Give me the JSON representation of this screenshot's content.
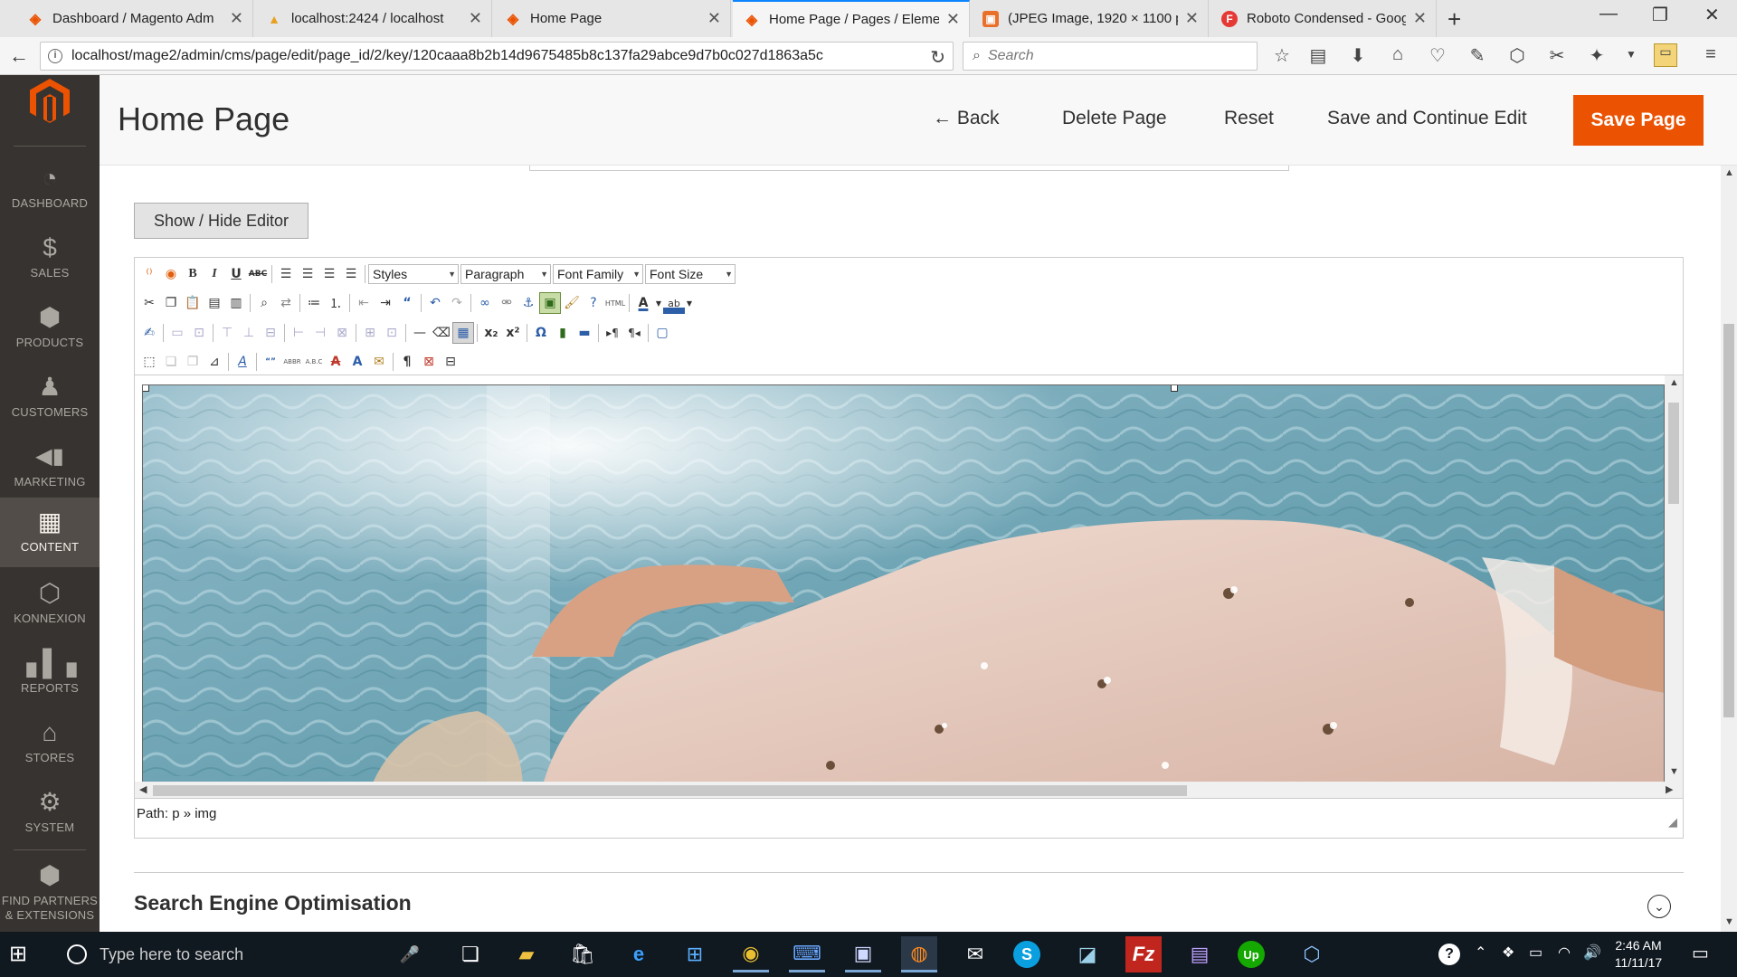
{
  "browser": {
    "tabs": [
      {
        "title": "Dashboard / Magento Adm",
        "favicon": "magento-icon",
        "active": false
      },
      {
        "title": "localhost:2424 / localhost",
        "favicon": "phpmyadmin-icon",
        "active": false
      },
      {
        "title": "Home Page",
        "favicon": "magento-icon",
        "active": false
      },
      {
        "title": "Home Page / Pages / Eleme",
        "favicon": "magento-icon",
        "active": true
      },
      {
        "title": "(JPEG Image, 1920 × 1100 p",
        "favicon": "image-icon",
        "active": false
      },
      {
        "title": "Roboto Condensed - Googl",
        "favicon": "google-fonts-icon",
        "active": false
      }
    ],
    "url": "localhost/mage2/admin/cms/page/edit/page_id/2/key/120caaa8b2b14d9675485b8c137fa29abce9d7b0c027d1863a5c",
    "search_placeholder": "Search"
  },
  "sidebar": {
    "items": [
      {
        "label": "DASHBOARD",
        "icon": "dashboard-icon",
        "glyph": "◔"
      },
      {
        "label": "SALES",
        "icon": "dollar-icon",
        "glyph": "$"
      },
      {
        "label": "PRODUCTS",
        "icon": "cube-icon",
        "glyph": "⬢"
      },
      {
        "label": "CUSTOMERS",
        "icon": "person-icon",
        "glyph": "♟"
      },
      {
        "label": "MARKETING",
        "icon": "megaphone-icon",
        "glyph": "📢"
      },
      {
        "label": "CONTENT",
        "icon": "layout-icon",
        "glyph": "▦"
      },
      {
        "label": "KONNEXION",
        "icon": "hexagon-icon",
        "glyph": "⬡"
      },
      {
        "label": "REPORTS",
        "icon": "bar-chart-icon",
        "glyph": "▮"
      },
      {
        "label": "STORES",
        "icon": "store-icon",
        "glyph": "⌂"
      },
      {
        "label": "SYSTEM",
        "icon": "gear-icon",
        "glyph": "⚙"
      },
      {
        "label_line1": "FIND PARTNERS",
        "label_line2": "& EXTENSIONS",
        "icon": "box-icon",
        "glyph": "⬢"
      }
    ]
  },
  "header": {
    "title": "Home Page",
    "back_label": "Back",
    "delete_label": "Delete Page",
    "reset_label": "Reset",
    "save_continue_label": "Save and Continue Edit",
    "save_label": "Save Page"
  },
  "editor": {
    "toggle_label": "Show / Hide Editor",
    "dropdowns": {
      "styles": "Styles",
      "format": "Paragraph",
      "font_family": "Font Family",
      "font_size": "Font Size"
    },
    "path": "Path: p » img"
  },
  "seo": {
    "title": "Search Engine Optimisation"
  },
  "taskbar": {
    "search_placeholder": "Type here to search",
    "time": "2:46 AM",
    "date": "11/11/17"
  },
  "colors": {
    "accent": "#eb5202",
    "sidebar_bg": "#373330",
    "sidebar_active": "#524d49"
  }
}
